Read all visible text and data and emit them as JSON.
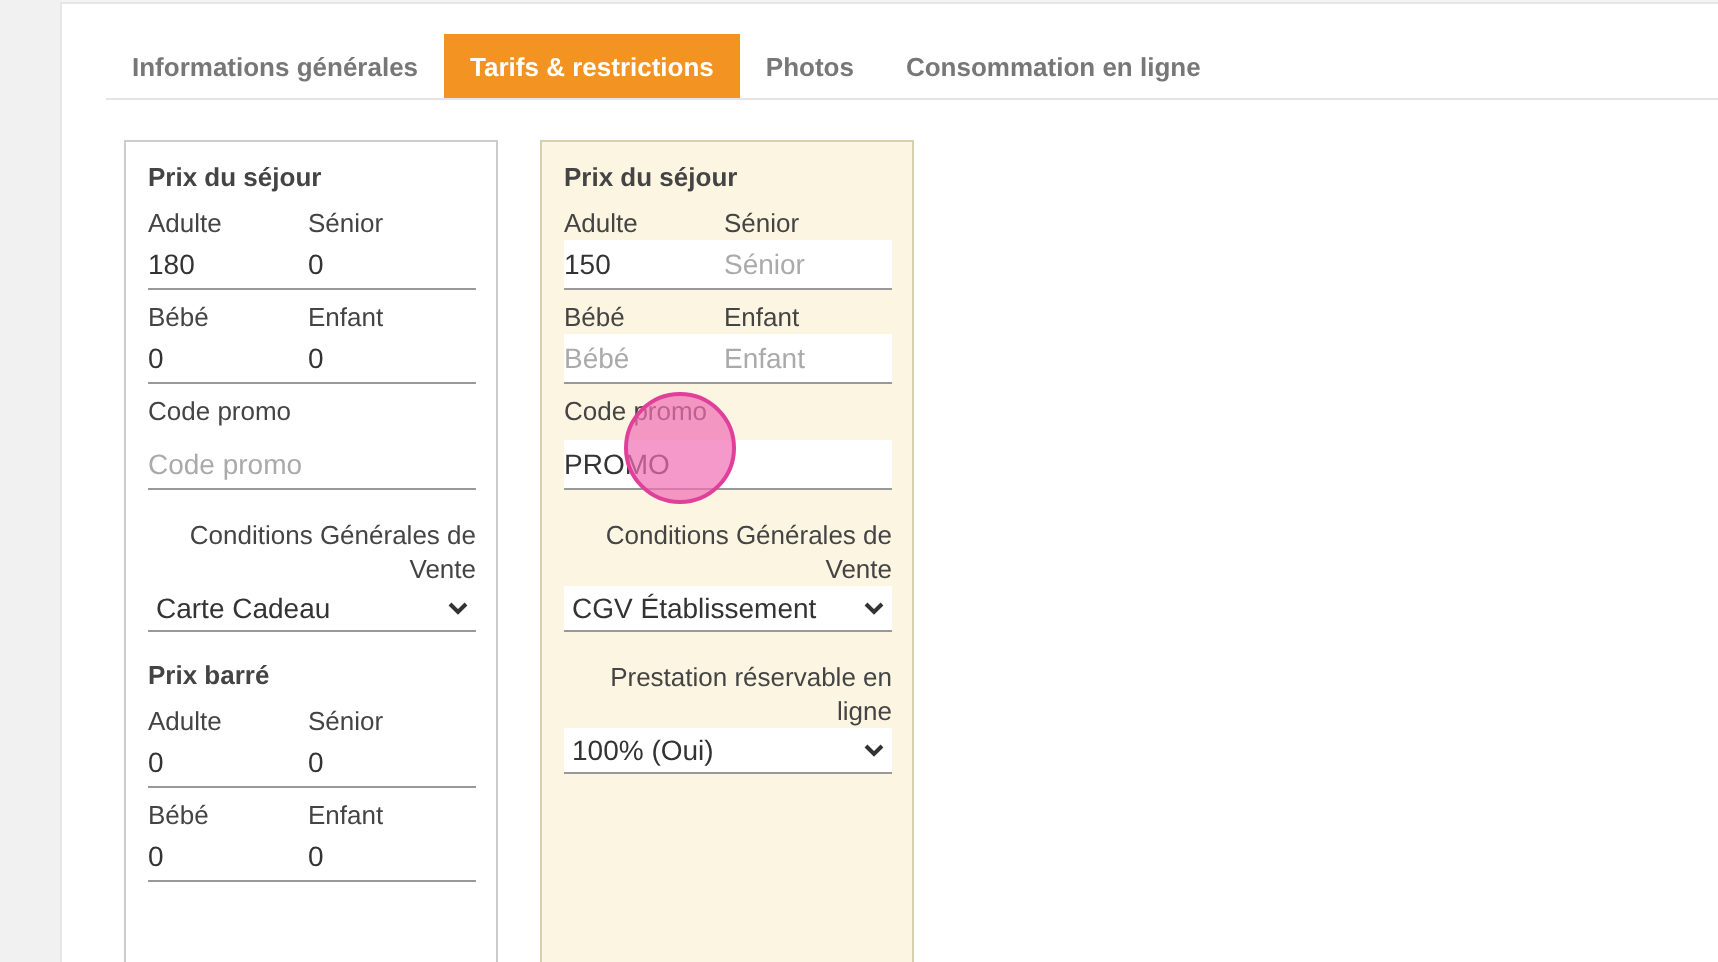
{
  "tabs": [
    {
      "label": "Informations générales",
      "selected": false
    },
    {
      "label": "Tarifs & restrictions",
      "selected": true
    },
    {
      "label": "Photos",
      "selected": false
    },
    {
      "label": "Consommation en ligne",
      "selected": false
    }
  ],
  "panels": [
    {
      "highlighted": false,
      "items": [
        {
          "kind": "heading",
          "text": "Prix du séjour"
        },
        {
          "kind": "pair",
          "fields": [
            {
              "label": "Adulte",
              "value": "180"
            },
            {
              "label": "Sénior",
              "value": "0"
            }
          ]
        },
        {
          "kind": "pair",
          "fields": [
            {
              "label": "Bébé",
              "value": "0"
            },
            {
              "label": "Enfant",
              "value": "0"
            }
          ]
        },
        {
          "kind": "text",
          "label": "Code promo",
          "placeholder": "Code promo"
        },
        {
          "kind": "select",
          "label": "Conditions Générales de Vente",
          "value": "Carte Cadeau"
        },
        {
          "kind": "heading",
          "text": "Prix barré"
        },
        {
          "kind": "pair",
          "fields": [
            {
              "label": "Adulte",
              "value": "0"
            },
            {
              "label": "Sénior",
              "value": "0"
            }
          ]
        },
        {
          "kind": "pair",
          "fields": [
            {
              "label": "Bébé",
              "value": "0"
            },
            {
              "label": "Enfant",
              "value": "0"
            }
          ]
        }
      ]
    },
    {
      "highlighted": true,
      "items": [
        {
          "kind": "heading",
          "text": "Prix du séjour"
        },
        {
          "kind": "pair",
          "fields": [
            {
              "label": "Adulte",
              "value": "150"
            },
            {
              "label": "Sénior",
              "placeholder": "Sénior"
            }
          ]
        },
        {
          "kind": "pair",
          "fields": [
            {
              "label": "Bébé",
              "placeholder": "Bébé"
            },
            {
              "label": "Enfant",
              "placeholder": "Enfant"
            }
          ]
        },
        {
          "kind": "text",
          "label": "Code promo",
          "value": "PROMO"
        },
        {
          "kind": "select",
          "label": "Conditions Générales de Vente",
          "value": "CGV Établissement"
        },
        {
          "kind": "select",
          "label": "Prestation réservable en ligne",
          "value": "100% (Oui)"
        }
      ]
    }
  ]
}
